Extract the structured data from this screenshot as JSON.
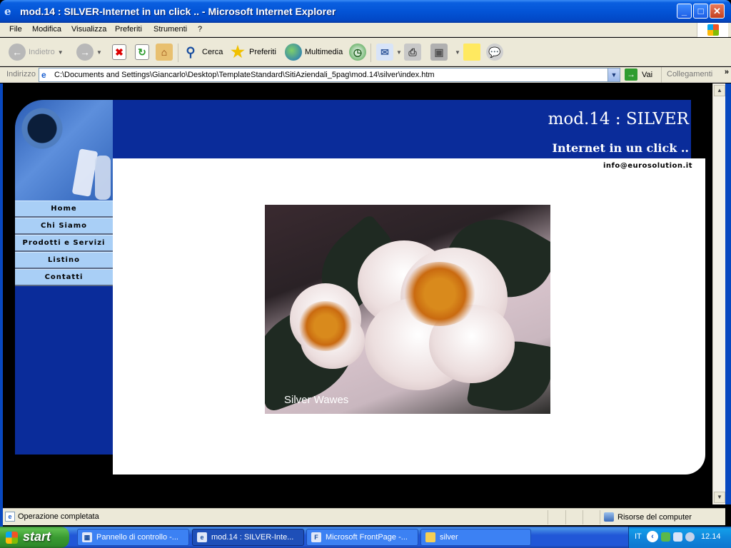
{
  "window": {
    "title": "mod.14 : SILVER-Internet in un click .. - Microsoft Internet Explorer",
    "minimize": "_",
    "maximize": "□",
    "close": "✕"
  },
  "menu": [
    "File",
    "Modifica",
    "Visualizza",
    "Preferiti",
    "Strumenti",
    "?"
  ],
  "toolbar": {
    "back": "Indietro",
    "search": "Cerca",
    "favorites": "Preferiti",
    "media": "Multimedia"
  },
  "address": {
    "label": "Indirizzo",
    "url": "C:\\Documents and Settings\\Giancarlo\\Desktop\\TemplateStandard\\SitiAziendali_5pag\\mod.14\\silver\\index.htm",
    "go": "Vai",
    "links": "Collegamenti"
  },
  "page": {
    "title": "mod.14 : SILVER",
    "subtitle": "Internet in un click ..",
    "email": "info@eurosolution.it",
    "nav": [
      "Home",
      "Chi Siamo",
      "Prodotti e Servizi",
      "Listino",
      "Contatti"
    ],
    "image_caption": "Silver Wawes"
  },
  "status": {
    "text": "Operazione completata",
    "zone": "Risorse del computer"
  },
  "taskbar": {
    "start": "start",
    "tasks": [
      "Pannello di controllo -...",
      "mod.14 : SILVER-Inte...",
      "Microsoft FrontPage -...",
      "silver"
    ],
    "lang": "IT",
    "clock": "12.14"
  },
  "colors": {
    "page_blue": "#0a2c9a",
    "nav_item": "#a9cff6",
    "xp_blue": "#0354d6"
  }
}
